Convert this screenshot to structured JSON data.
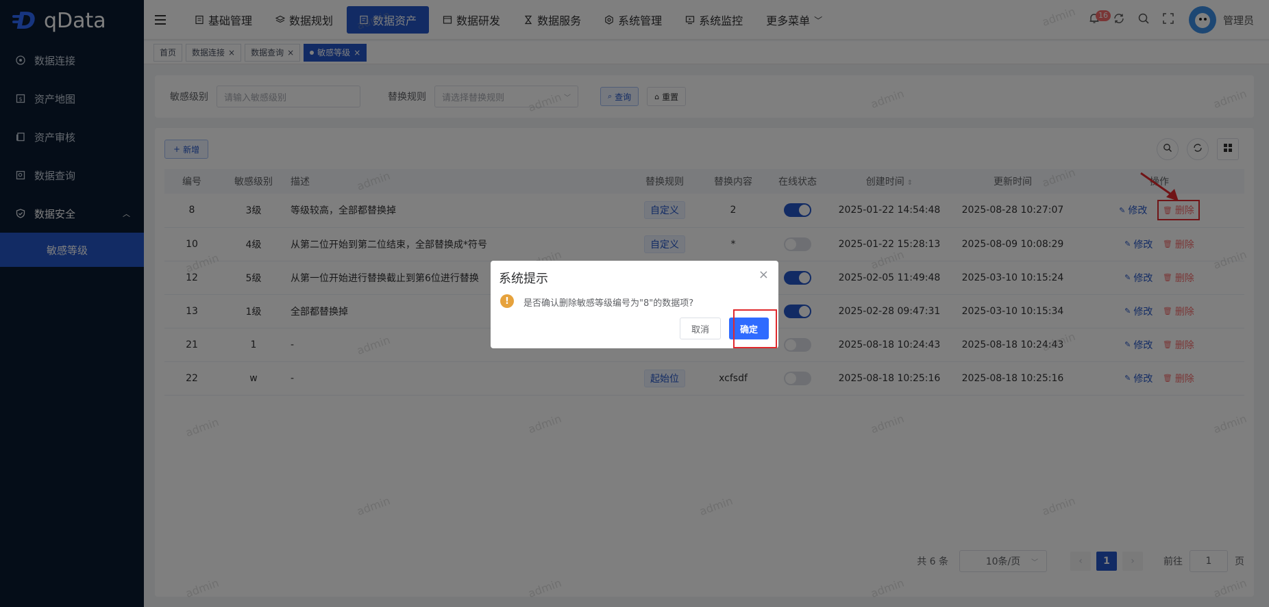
{
  "app": {
    "logo_text": "qData"
  },
  "sidebar": {
    "items": [
      {
        "label": "数据连接",
        "icon": "target-icon"
      },
      {
        "label": "资产地图",
        "icon": "map-icon"
      },
      {
        "label": "资产审核",
        "icon": "audit-icon"
      },
      {
        "label": "数据查询",
        "icon": "query-icon"
      },
      {
        "label": "数据安全",
        "icon": "shield-icon",
        "expanded": true
      }
    ],
    "sub_item": {
      "label": "敏感等级",
      "active": true
    }
  },
  "topnav": {
    "items": [
      {
        "label": "基础管理",
        "icon": "base-icon"
      },
      {
        "label": "数据规划",
        "icon": "layers-icon"
      },
      {
        "label": "数据资产",
        "icon": "asset-icon",
        "active": true
      },
      {
        "label": "数据研发",
        "icon": "dev-icon"
      },
      {
        "label": "数据服务",
        "icon": "hourglass-icon"
      },
      {
        "label": "系统管理",
        "icon": "gear-icon"
      },
      {
        "label": "系统监控",
        "icon": "monitor-icon"
      },
      {
        "label": "更多菜单",
        "icon": "chevron-down-icon"
      }
    ],
    "notification_count": "16",
    "username": "管理员"
  },
  "tags": [
    {
      "label": "首页",
      "closable": false
    },
    {
      "label": "数据连接",
      "closable": true
    },
    {
      "label": "数据查询",
      "closable": true
    },
    {
      "label": "敏感等级",
      "closable": true,
      "active": true
    }
  ],
  "search": {
    "level_label": "敏感级别",
    "level_placeholder": "请输入敏感级别",
    "rule_label": "替换规则",
    "rule_placeholder": "请选择替换规则",
    "query_button": "查询",
    "reset_button": "重置"
  },
  "table": {
    "add_button": "新增",
    "columns": [
      "编号",
      "敏感级别",
      "描述",
      "替换规则",
      "替换内容",
      "在线状态",
      "创建时间",
      "更新时间",
      "操作"
    ],
    "rows": [
      {
        "id": "8",
        "level": "3级",
        "desc": "等级较高，全部都替换掉",
        "rule": "自定义",
        "content": "2",
        "online": true,
        "created": "2025-01-22 14:54:48",
        "updated": "2025-08-28 10:27:07"
      },
      {
        "id": "10",
        "level": "4级",
        "desc": "从第二位开始到第二位结束，全部替换成*符号",
        "rule": "自定义",
        "content": "*",
        "online": false,
        "created": "2025-01-22 15:28:13",
        "updated": "2025-08-09 10:08:29"
      },
      {
        "id": "12",
        "level": "5级",
        "desc": "从第一位开始进行替换截止到第6位进行替换",
        "rule": "",
        "content": "",
        "online": true,
        "created": "2025-02-05 11:49:48",
        "updated": "2025-03-10 10:15:24"
      },
      {
        "id": "13",
        "level": "1级",
        "desc": "全部都替换掉",
        "rule": "",
        "content": "",
        "online": true,
        "created": "2025-02-28 09:47:31",
        "updated": "2025-03-10 10:15:34"
      },
      {
        "id": "21",
        "level": "1",
        "desc": "-",
        "rule": "",
        "content": "",
        "online": false,
        "created": "2025-08-18 10:24:43",
        "updated": "2025-08-18 10:24:43"
      },
      {
        "id": "22",
        "level": "w",
        "desc": "-",
        "rule": "起始位",
        "content": "xcfsdf",
        "online": false,
        "created": "2025-08-18 10:25:16",
        "updated": "2025-08-18 10:25:16"
      }
    ],
    "edit_label": "修改",
    "delete_label": "删除"
  },
  "pagination": {
    "total_text": "共 6 条",
    "page_size": "10条/页",
    "current_page": "1",
    "goto_label": "前往",
    "goto_value": "1",
    "page_suffix": "页"
  },
  "dialog": {
    "title": "系统提示",
    "message": "是否确认删除敏感等级编号为\"8\"的数据项?",
    "cancel_label": "取消",
    "confirm_label": "确定"
  },
  "watermark": "admin",
  "colors": {
    "primary": "#2456c8",
    "sidebar_bg": "#0b1a30",
    "danger": "#f56c6c",
    "warning": "#e6a23c",
    "annotation": "#e0282c"
  }
}
